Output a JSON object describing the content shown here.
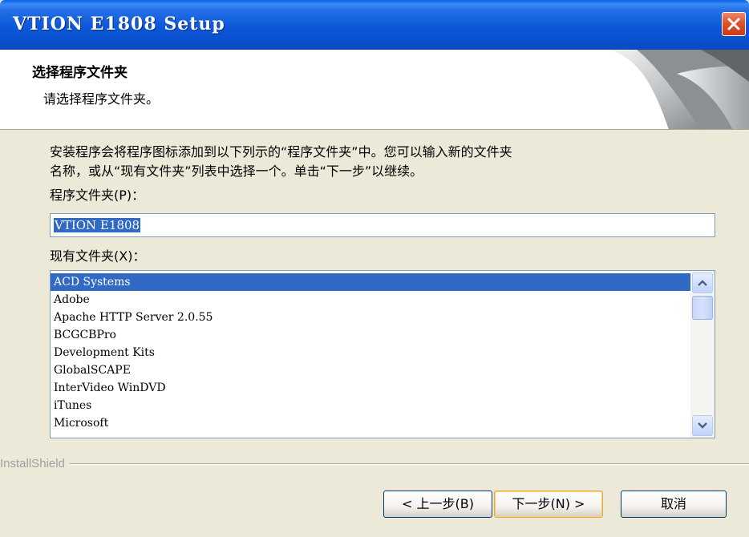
{
  "window": {
    "title": "VTION E1808 Setup"
  },
  "header": {
    "title": "选择程序文件夹",
    "subtitle": "请选择程序文件夹。"
  },
  "body": {
    "intro_line1": "安装程序会将程序图标添加到以下列示的“程序文件夹”中。您可以输入新的文件夹",
    "intro_line2": "名称，或从“现有文件夹”列表中选择一个。单击“下一步”以继续。",
    "program_folder_label": "程序文件夹(P)：",
    "program_folder_value": "VTION E1808",
    "existing_folders_label": "现有文件夹(X)：",
    "existing_folders": [
      "ACD Systems",
      "Adobe",
      "Apache HTTP Server 2.0.55",
      "BCGCBPro",
      "Development Kits",
      "GlobalSCAPE",
      "InterVideo WinDVD",
      "iTunes",
      "Microsoft"
    ],
    "selected_folder": "ACD Systems"
  },
  "footer": {
    "brand": "InstallShield",
    "back_label": "< 上一步(B)",
    "next_label": "下一步(N) >",
    "cancel_label": "取消"
  },
  "colors": {
    "titlebar": "#0A57D8",
    "selection": "#316AC5",
    "dialog_bg": "#ECE9D8",
    "close_button": "#E0502A"
  },
  "icons": {
    "close": "close-x-icon",
    "scroll_up": "chevron-up-icon",
    "scroll_down": "chevron-down-icon"
  }
}
